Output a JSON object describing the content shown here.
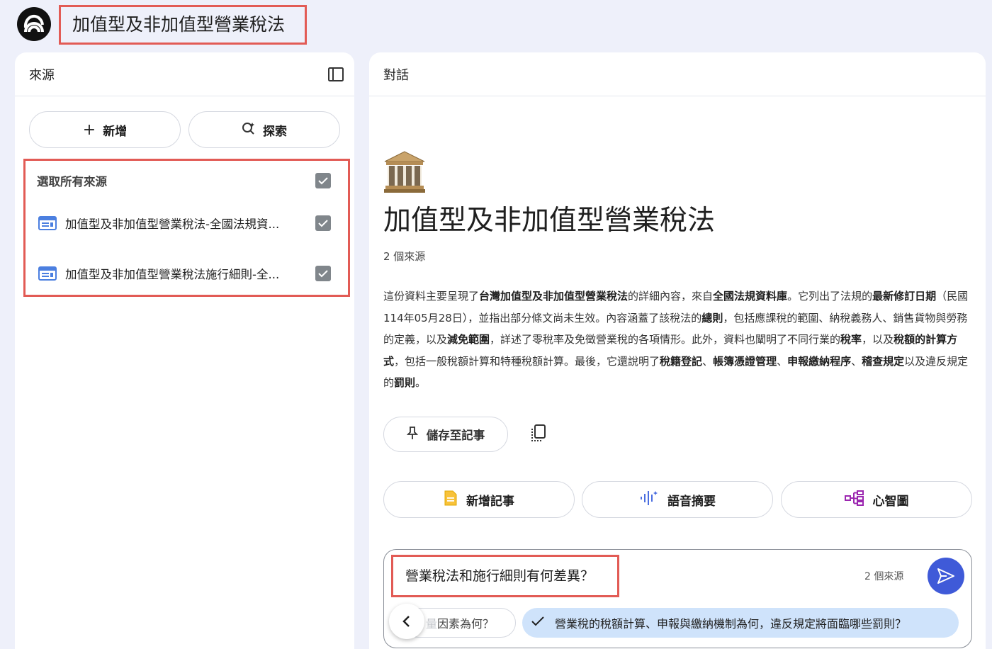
{
  "app": {
    "notebook_title": "加值型及非加值型營業稅法",
    "logo_icon": "notebooklm-logo-icon"
  },
  "sources_panel": {
    "title": "來源",
    "add_label": "新增",
    "explore_label": "探索",
    "select_all_label": "選取所有來源",
    "items": [
      {
        "label": "加值型及非加值型營業稅法-全國法規資...",
        "checked": true
      },
      {
        "label": "加值型及非加值型營業稅法施行細則-全...",
        "checked": true
      }
    ]
  },
  "chat_panel": {
    "title": "對話",
    "notebook_title": "加值型及非加值型營業稅法",
    "emoji": "classical-building-icon",
    "source_count": "2 個來源",
    "summary": {
      "s1": "這份資料主要呈現了",
      "b1": "台灣加值型及非加值型營業稅法",
      "s2": "的詳細內容，來自",
      "b2": "全國法規資料庫",
      "s3": "。它列出了法規的",
      "b3": "最新修訂日期",
      "s4": "（民國114年05月28日），並指出部分條文尚未生效。內容涵蓋了該稅法的",
      "b4": "總則",
      "s5": "，包括應課稅的範圍、納稅義務人、銷售貨物與勞務的定義，以及",
      "b5": "減免範圍",
      "s6": "，詳述了零稅率及免徵營業稅的各項情形。此外，資料也闡明了不同行業的",
      "b6": "稅率",
      "s7": "，以及",
      "b7": "稅額的計算方式",
      "s8": "，包括一般稅額計算和特種稅額計算。最後，它還說明了",
      "b8": "稅籍登記",
      "s9": "、",
      "b9": "帳簿憑證管理",
      "s10": "、",
      "b10": "申報繳納程序",
      "s11": "、",
      "b11": "稽查規定",
      "s12": "以及違反規定的",
      "b12": "罰則",
      "s13": "。"
    },
    "save_note_label": "儲存至記事",
    "actions": {
      "add_note": "新增記事",
      "audio_overview": "語音摘要",
      "mind_map": "心智圖"
    },
    "composer": {
      "query": "營業稅法和施行細則有何差異？",
      "source_count": "2 個來源",
      "prev_suggestion_faded": "量",
      "prev_suggestion": "因素為何？",
      "suggestion": "營業稅的稅額計算、申報與繳納機制為何，違反規定將面臨哪些罰則？"
    }
  },
  "colors": {
    "highlight_border": "#e25b55",
    "send_button": "#3f5ad8",
    "suggestion_chip": "#cfe3fb",
    "background": "#eef0fa"
  }
}
